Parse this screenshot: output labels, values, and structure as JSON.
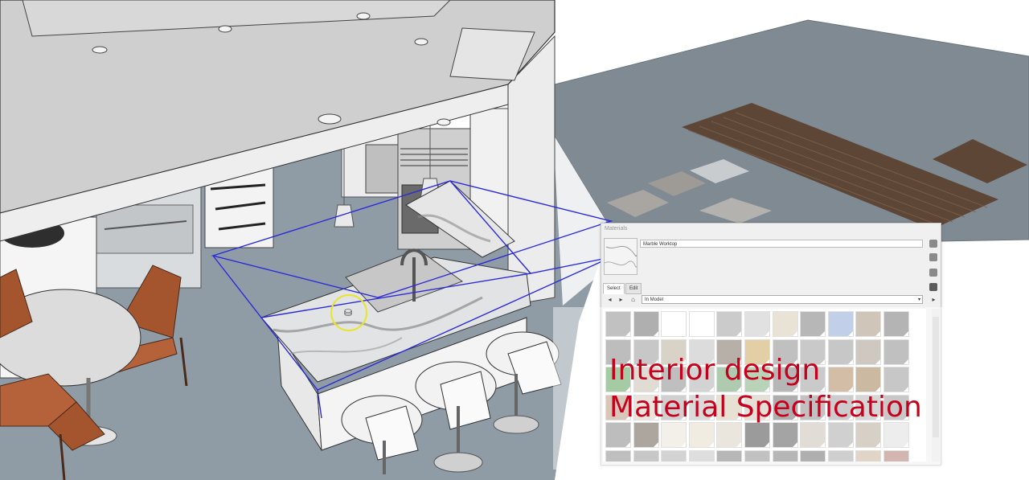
{
  "materials_panel": {
    "title": "Materials",
    "material_name": "Marble Worktop",
    "tabs": [
      {
        "label": "Select",
        "active": true
      },
      {
        "label": "Edit",
        "active": false
      }
    ],
    "collection": "In Model",
    "swatch_colors": [
      "#8f8f8f",
      "#6e6e6e",
      "#ffffff",
      "#ffffff",
      "#a0a0a0",
      "#c9c9c9",
      "#d8cdb4",
      "#7d7d7d",
      "#8fa8d6",
      "#a89880",
      "#777777",
      "#888888",
      "#9a9a9a",
      "#b8ad9a",
      "#c0c0c0",
      "#7a6f62",
      "#caa85c",
      "#8c8c8c",
      "#9d9d9d",
      "#9a9a9a",
      "#a79c8f",
      "#8c8c8c",
      "#5aa05a",
      "#c8c0b0",
      "#8a8a8a",
      "#b0b0b0",
      "#6ea06e",
      "#7eb07e",
      "#7b7b7b",
      "#9e9e9e",
      "#b0875e",
      "#a08255",
      "#9a9a9a",
      "#b89a80",
      "#d8d0c0",
      "#aaaaaa",
      "#bcbcbc",
      "#d4c9b0",
      "#cfc6b4",
      "#6c6c6c",
      "#8e8e8e",
      "#a3a3a3",
      "#b5b5b5",
      "#9c9c9c",
      "#888888",
      "#6a5d50",
      "#e8e3d8",
      "#e6dcc8",
      "#d9d2c4",
      "#4a4a4a",
      "#5a5a5a",
      "#c8c0b4",
      "#a9a9a9",
      "#b5aa98",
      "#dedede",
      "#8b8b8b",
      "#9a9a9a",
      "#b0b0b0",
      "#c4c4c4",
      "#7c7c7c",
      "#8e8e8e",
      "#7a7a7a",
      "#6d6d6d",
      "#a8a8a8",
      "#c7b299",
      "#b07a6e"
    ]
  },
  "caption": {
    "line1": "Interior design",
    "line2": "Material Specification"
  }
}
